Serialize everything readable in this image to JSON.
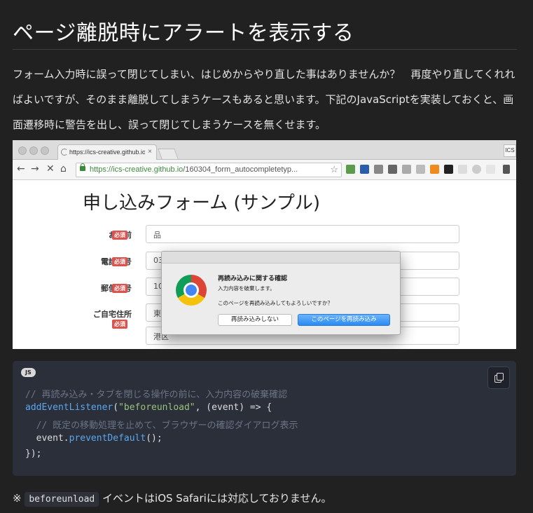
{
  "heading": "ページ離脱時にアラートを表示する",
  "paragraph": "フォーム入力時に誤って閉じてしまい、はじめからやり直した事はありませんか？　再度やり直してくれればよいですが、そのまま離脱してしまうケースもあると思います。下記のJavaScriptを実装しておくと、画面遷移時に警告を出し、誤って閉じてしまうケースを無くせます。",
  "browser": {
    "tab_title": "https://ics-creative.github.io",
    "tab_close": "×",
    "corner_label": "ICS",
    "url_host": "https://ics-creative.github.io",
    "url_path": "/160304_form_autocompletetyp...",
    "nav": {
      "back": "←",
      "forward": "→",
      "stop": "✕",
      "home": "⌂",
      "star": "☆"
    }
  },
  "form": {
    "title": "申し込みフォーム (サンプル)",
    "required_badge": "必須",
    "fields": [
      {
        "label": "お名前",
        "value": "品"
      },
      {
        "label": "電話番号",
        "value": "03"
      },
      {
        "label": "郵便番号",
        "value": "10"
      },
      {
        "label": "ご自宅住所",
        "value": "東京都"
      },
      {
        "label": "",
        "value": "港区"
      }
    ]
  },
  "dialog": {
    "title": "再読み込みに関する確認",
    "message1": "入力内容を破棄します。",
    "message2": "このページを再読み込みしてもよろしいですか？",
    "cancel_label": "再読み込みしない",
    "confirm_label": "このページを再読み込み"
  },
  "code": {
    "language": "JS",
    "line1_comment": "// 再読み込み・タブを閉じる操作の前に、入力内容の破棄確認",
    "line2_fn": "addEventListener",
    "line2_open": "(",
    "line2_str": "\"beforeunload\"",
    "line2_rest": ", (event) => {",
    "line3_comment": "  // 既定の移動処理を止めて、ブラウザーの確認ダイアログ表示",
    "line4_obj": "  event.",
    "line4_fn": "preventDefault",
    "line4_rest": "();",
    "line5": "});"
  },
  "note": {
    "prefix": "※ ",
    "code": "beforeunload",
    "suffix": " イベントはiOS Safariには対応しておりません。"
  },
  "icons": [
    "copy-icon",
    "chrome-logo-icon",
    "lock-icon",
    "star-icon"
  ]
}
